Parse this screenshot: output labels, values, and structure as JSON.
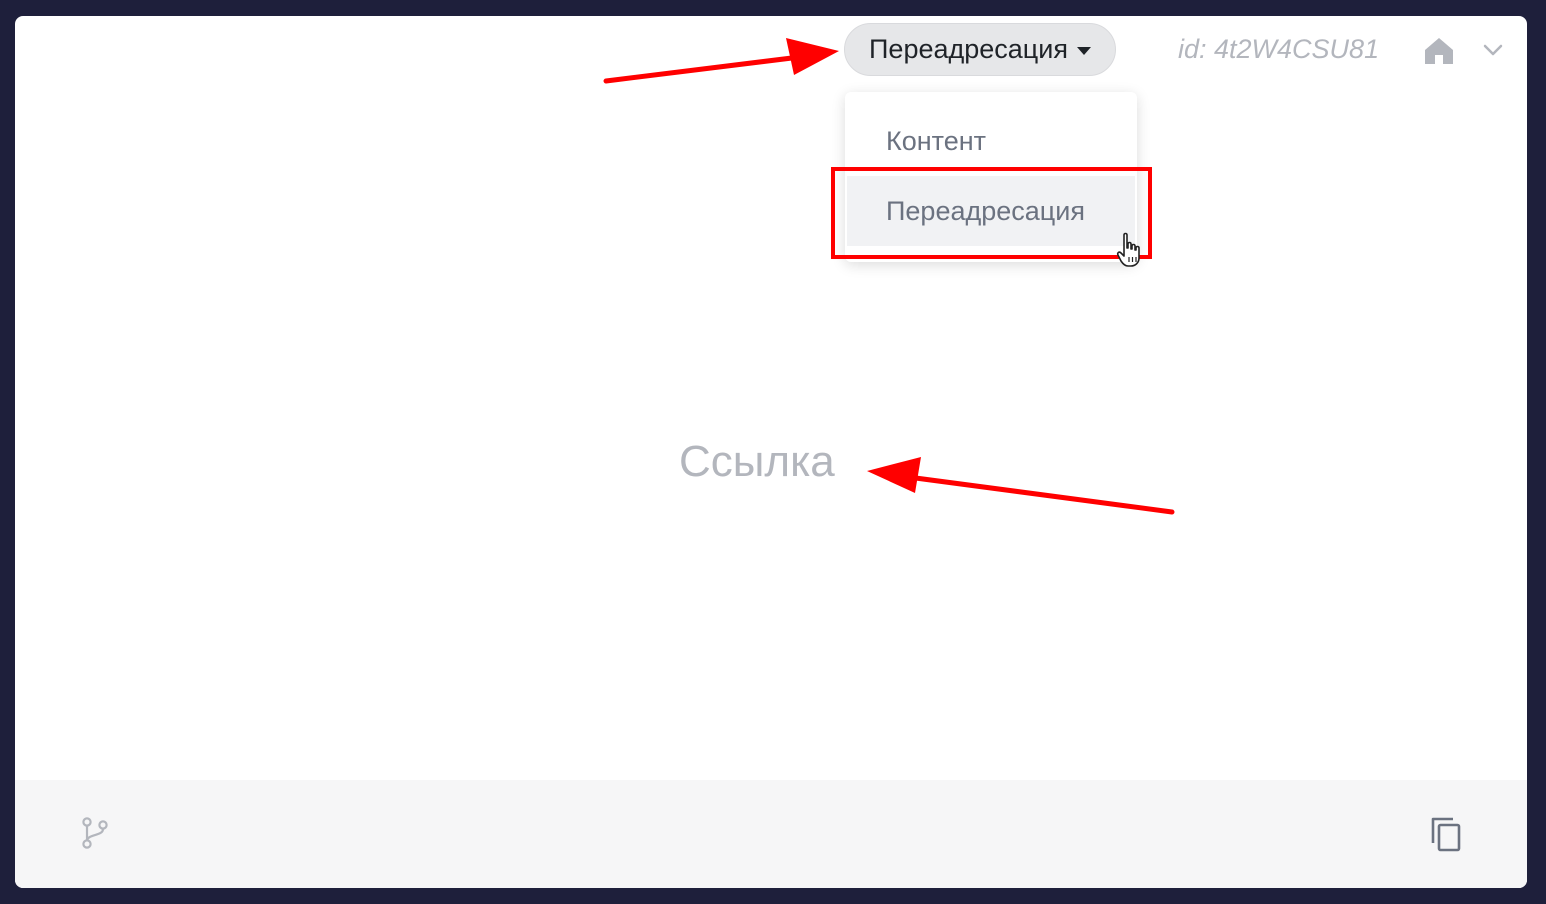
{
  "header": {
    "mode_button_label": "Переадресация",
    "id_label": "id: 4t2W4CSU81"
  },
  "dropdown": {
    "items": [
      {
        "label": "Контент"
      },
      {
        "label": "Переадресация"
      }
    ]
  },
  "main": {
    "link_placeholder": "Ссылка"
  },
  "icons": {
    "home": "home-icon",
    "chevron": "chevron-down-icon",
    "branch": "branch-icon",
    "copy": "copy-icon",
    "cursor": "hand-cursor-icon"
  },
  "colors": {
    "annotation": "#ff0000",
    "frame_background": "#1e1f3b",
    "muted_text": "#b3b6bd"
  }
}
